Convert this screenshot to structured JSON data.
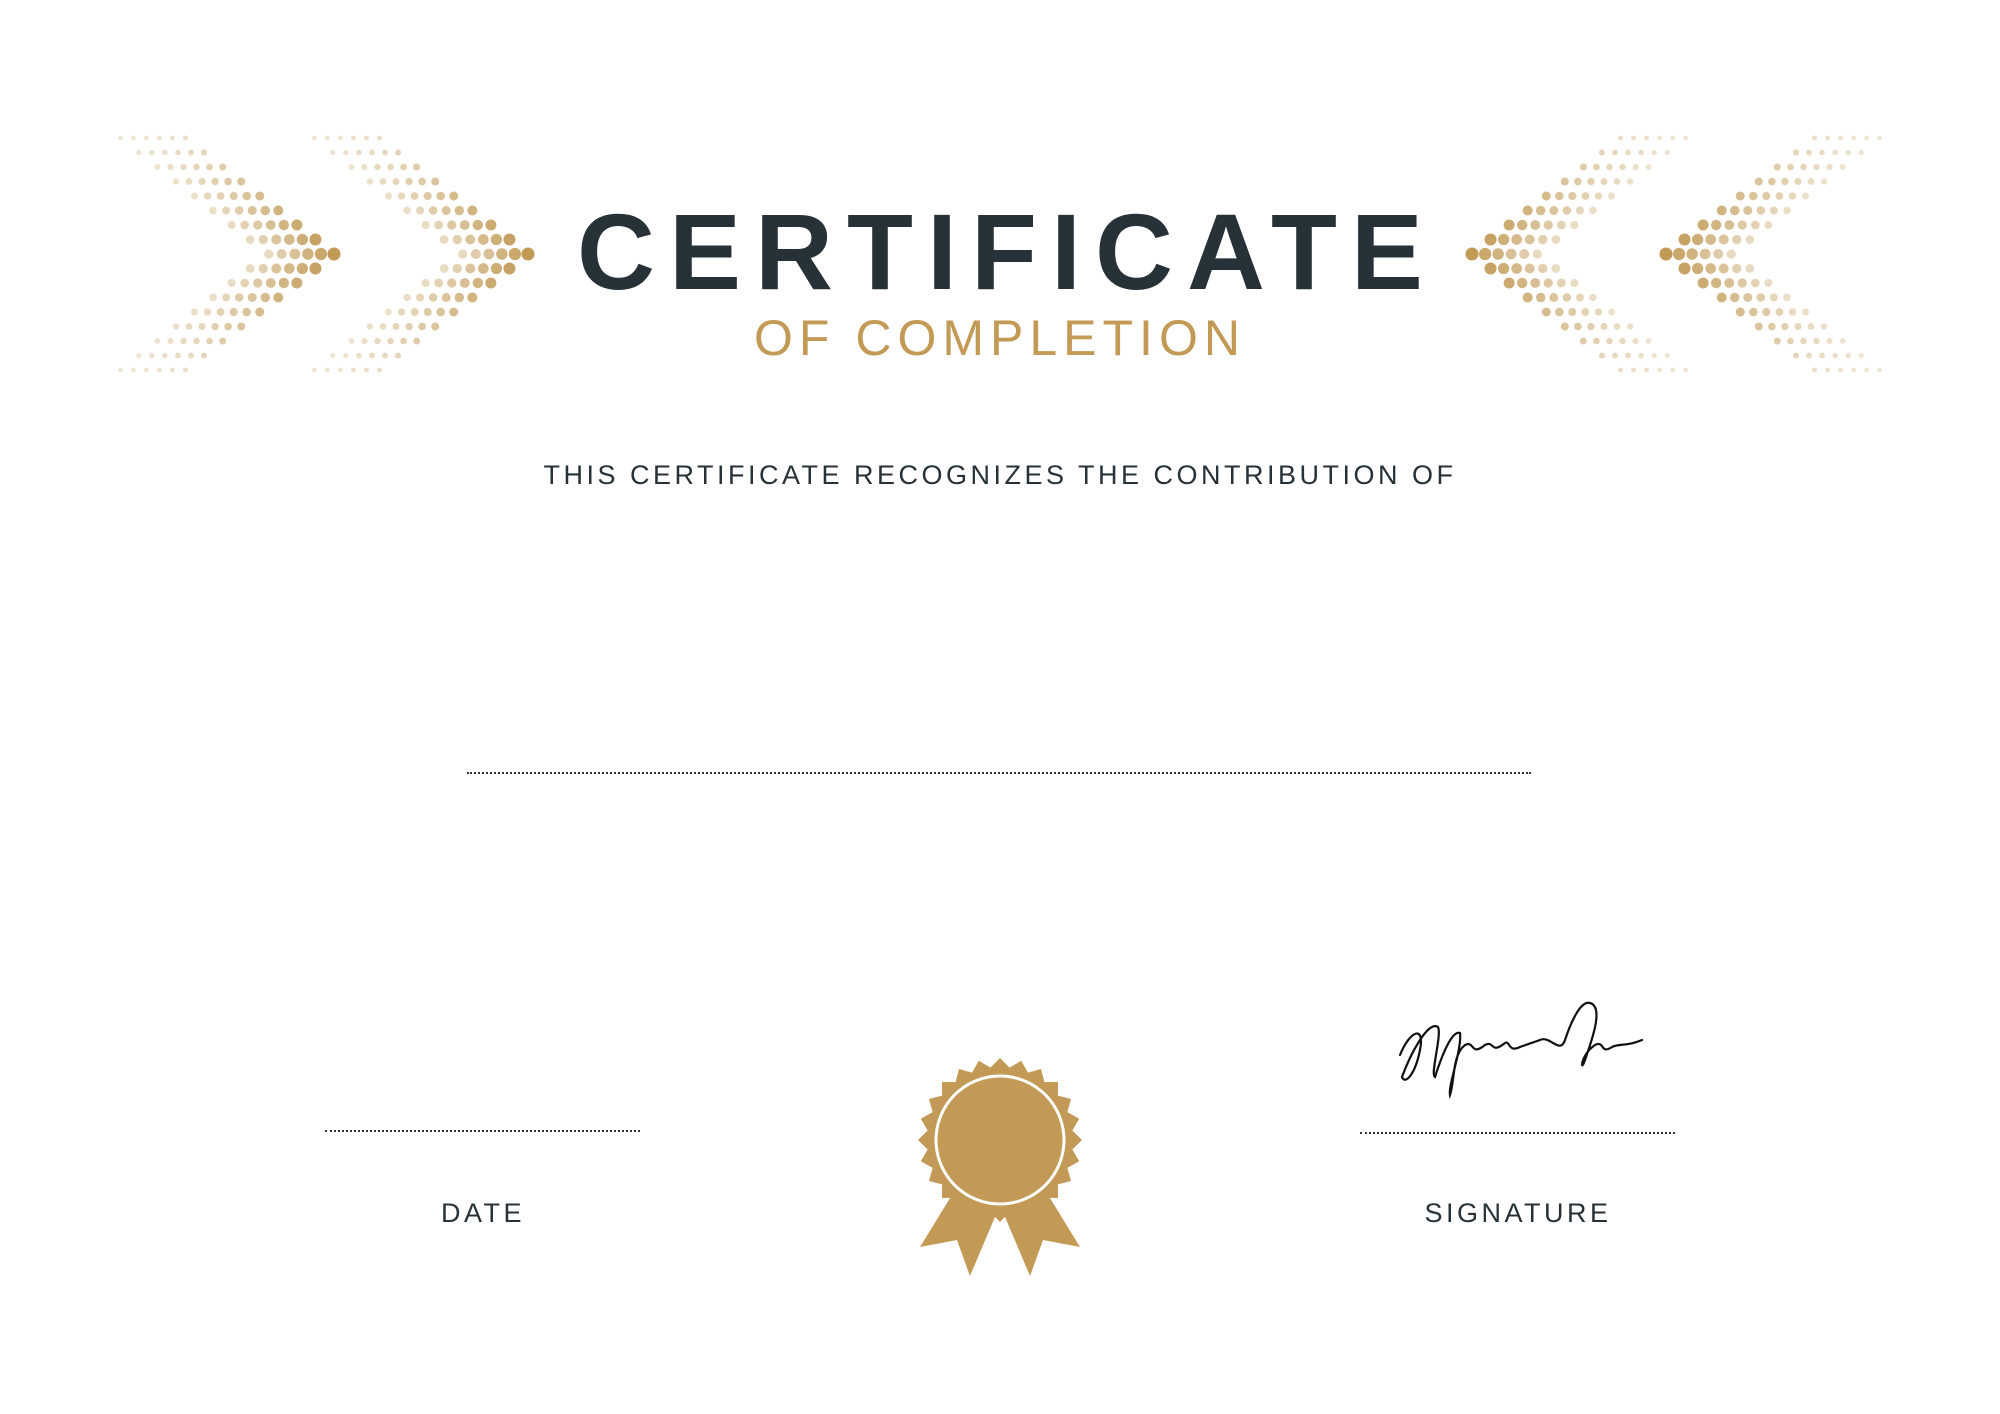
{
  "certificate": {
    "title": "CERTIFICATE",
    "subtitle": "OF COMPLETION",
    "recognition_text": "THIS CERTIFICATE RECOGNIZES THE CONTRIBUTION OF",
    "date_label": "DATE",
    "signature_label": "SIGNATURE"
  },
  "colors": {
    "dark": "#263238",
    "gold": "#c29a56"
  },
  "icons": [
    "chevron-dots-decoration",
    "award-seal-icon",
    "handwritten-signature"
  ]
}
